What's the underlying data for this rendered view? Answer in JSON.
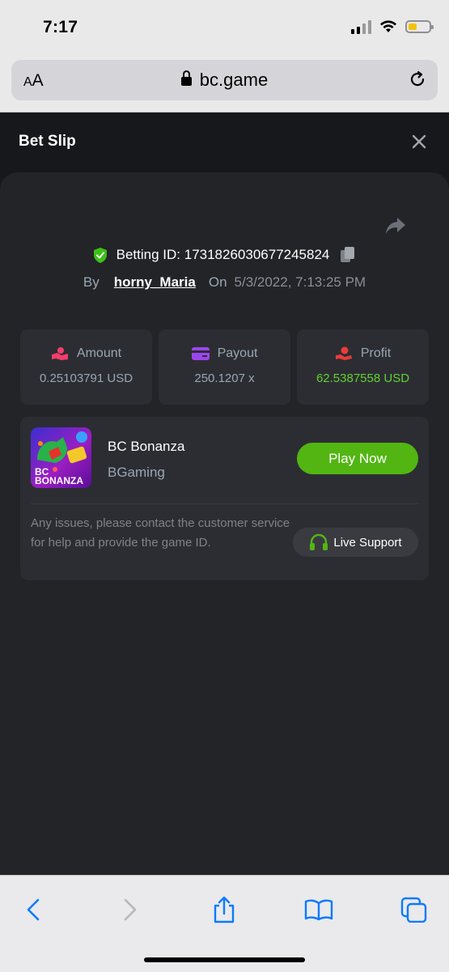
{
  "status": {
    "time": "7:17",
    "battery_level": 0.35,
    "battery_color": "#f4c20d"
  },
  "browser": {
    "aa_small": "A",
    "aa_large": "A",
    "url": "bc.game"
  },
  "bet_slip": {
    "title": "Bet Slip",
    "betting_id_label": "Betting ID:",
    "betting_id": "1731826030677245824",
    "by_label": "By",
    "username": "horny_Maria",
    "on_label": "On",
    "date": "5/3/2022, 7:13:25 PM"
  },
  "stats": {
    "amount_label": "Amount",
    "amount_value": "0.25103791 USD",
    "payout_label": "Payout",
    "payout_value": "250.1207 x",
    "profit_label": "Profit",
    "profit_value": "62.5387558 USD",
    "profit_color": "#62d132"
  },
  "game": {
    "thumb_line1": "BC",
    "thumb_line2": "BONANZA",
    "name": "BC Bonanza",
    "provider": "BGaming",
    "play_label": "Play Now",
    "help_text": "Any issues, please contact the customer service for help and provide the game ID.",
    "support_label": "Live Support"
  },
  "toolbar": {
    "icons": [
      "back-icon",
      "forward-icon",
      "share-icon",
      "bookmarks-icon",
      "tabs-icon"
    ]
  },
  "colors": {
    "accent": "#52b512",
    "panel": "#232428",
    "ios_blue": "#0a7aff"
  }
}
